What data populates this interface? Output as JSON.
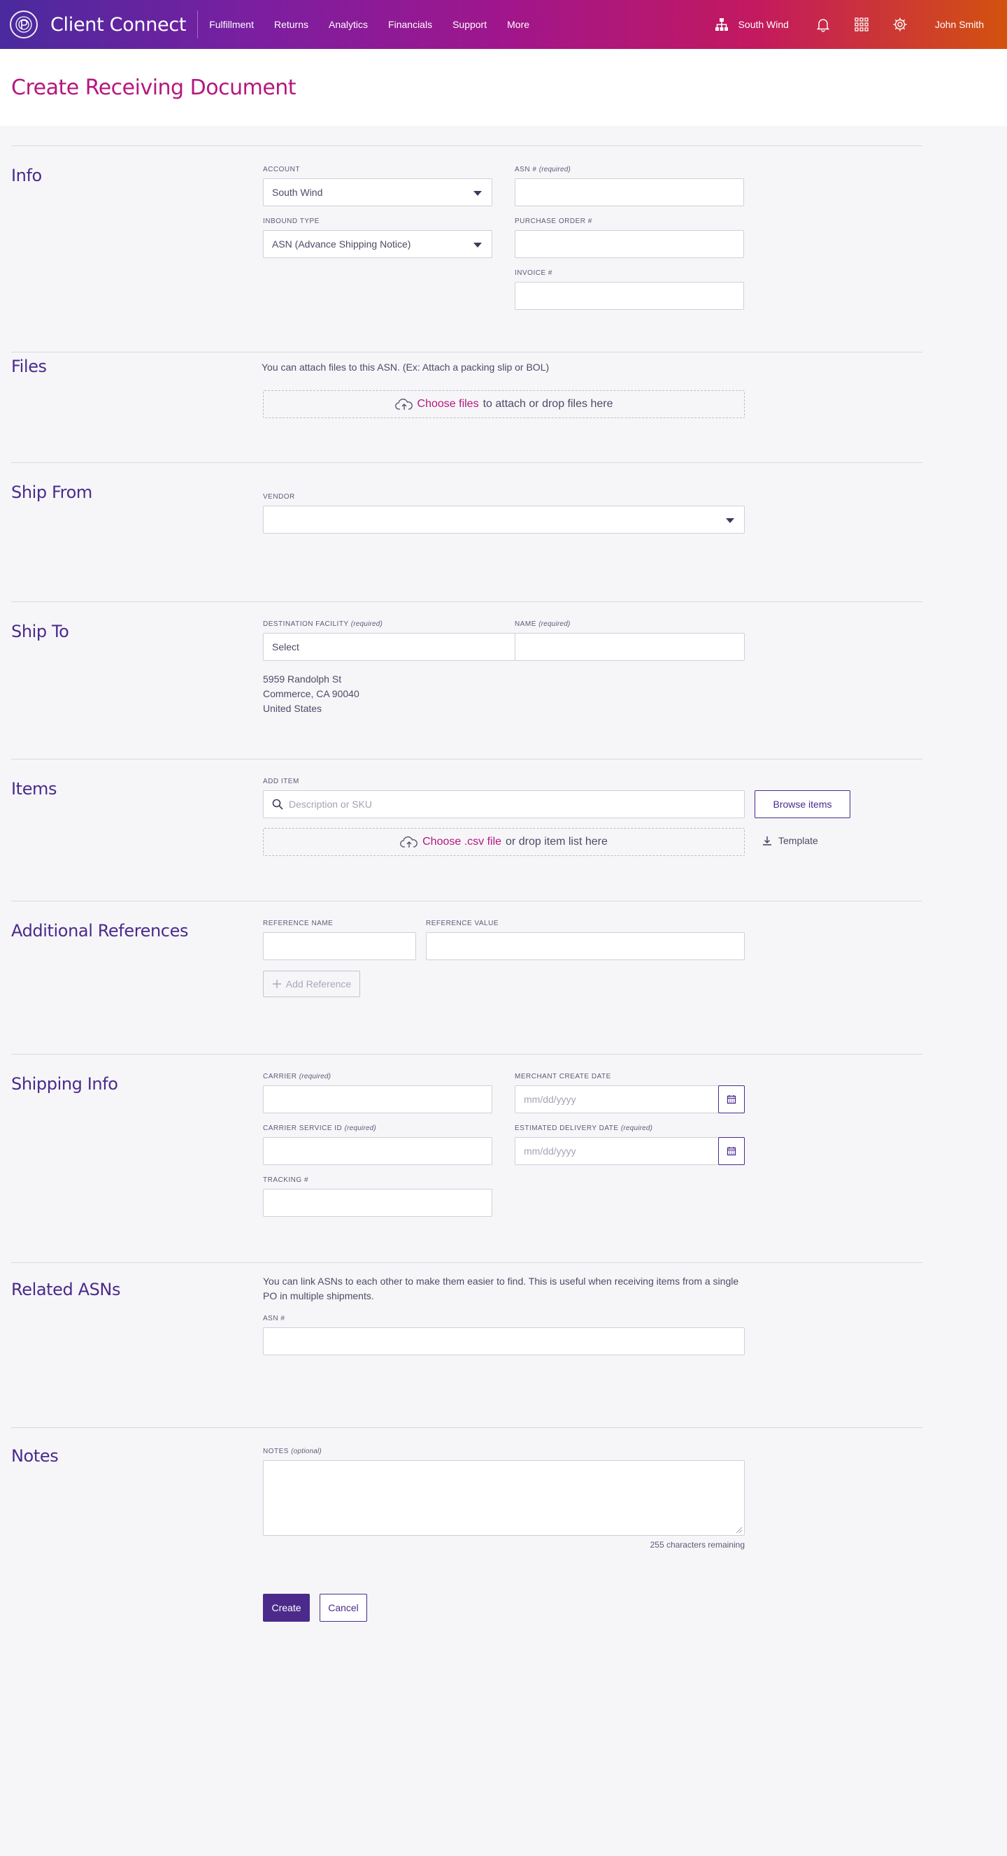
{
  "app": {
    "name": "Client Connect",
    "nav": [
      "Fulfillment",
      "Returns",
      "Analytics",
      "Financials",
      "Support",
      "More"
    ],
    "account_name": "South Wind",
    "user_name": "John Smith",
    "icons": [
      "org-chart-icon",
      "bell-icon",
      "apps-grid-icon",
      "gear-icon"
    ],
    "brand_colors": {
      "gradient_start": "#4a2a9e",
      "gradient_end": "#d3520f",
      "accent": "#b5177e",
      "primary": "#4b2a8c"
    }
  },
  "page": {
    "title": "Create Receiving Document"
  },
  "info": {
    "title": "Info",
    "account_label": "ACCOUNT",
    "account_value": "South Wind",
    "inbound_type_label": "INBOUND TYPE",
    "inbound_type_value": "ASN (Advance Shipping Notice)",
    "asn_label": "ASN #",
    "asn_req": "(required)",
    "asn_value": "",
    "po_label": "PURCHASE ORDER #",
    "po_value": "",
    "invoice_label": "INVOICE #",
    "invoice_value": ""
  },
  "files": {
    "title": "Files",
    "help": "You can attach files to this ASN. (Ex: Attach a packing slip or BOL)",
    "choose_link": "Choose files",
    "drop_text": "to attach or drop files here"
  },
  "ship_from": {
    "title": "Ship From",
    "vendor_label": "VENDOR",
    "vendor_value": ""
  },
  "ship_to": {
    "title": "Ship To",
    "facility_label": "DESTINATION FACILITY",
    "facility_req": "(required)",
    "facility_value": "Select",
    "name_label": "NAME",
    "name_req": "(required)",
    "name_value": "",
    "address": [
      "5959 Randolph St",
      "Commerce, CA 90040",
      "United States"
    ]
  },
  "items": {
    "title": "Items",
    "add_item_label": "ADD ITEM",
    "search_placeholder": "Description or SKU",
    "browse_button": "Browse items",
    "choose_link": "Choose .csv file",
    "drop_text": "or drop item list here",
    "template_link": "Template"
  },
  "additional_references": {
    "title": "Additional References",
    "ref_name_label": "REFERENCE NAME",
    "ref_value_label": "REFERENCE VALUE",
    "ref_name_value": "",
    "ref_value_value": "",
    "add_button": "Add Reference"
  },
  "shipping_info": {
    "title": "Shipping Info",
    "carrier_label": "CARRIER",
    "carrier_req": "(required)",
    "carrier_value": "",
    "service_label": "CARRIER SERVICE ID",
    "service_req": "(required)",
    "service_value": "",
    "tracking_label": "TRACKING #",
    "tracking_value": "",
    "merchant_date_label": "MERCHANT CREATE DATE",
    "merchant_date_placeholder": "mm/dd/yyyy",
    "delivery_date_label": "ESTIMATED DELIVERY DATE",
    "delivery_date_req": "(required)",
    "delivery_date_placeholder": "mm/dd/yyyy"
  },
  "related_asns": {
    "title": "Related ASNs",
    "help": "You can link ASNs to each other to make them easier to find. This is useful when receiving items from a single PO in multiple shipments.",
    "asn_label": "ASN #",
    "asn_value": ""
  },
  "notes": {
    "title": "Notes",
    "label": "NOTES",
    "label_opt": "(optional)",
    "value": "",
    "remaining": "255 characters remaining"
  },
  "actions": {
    "create": "Create",
    "cancel": "Cancel"
  }
}
